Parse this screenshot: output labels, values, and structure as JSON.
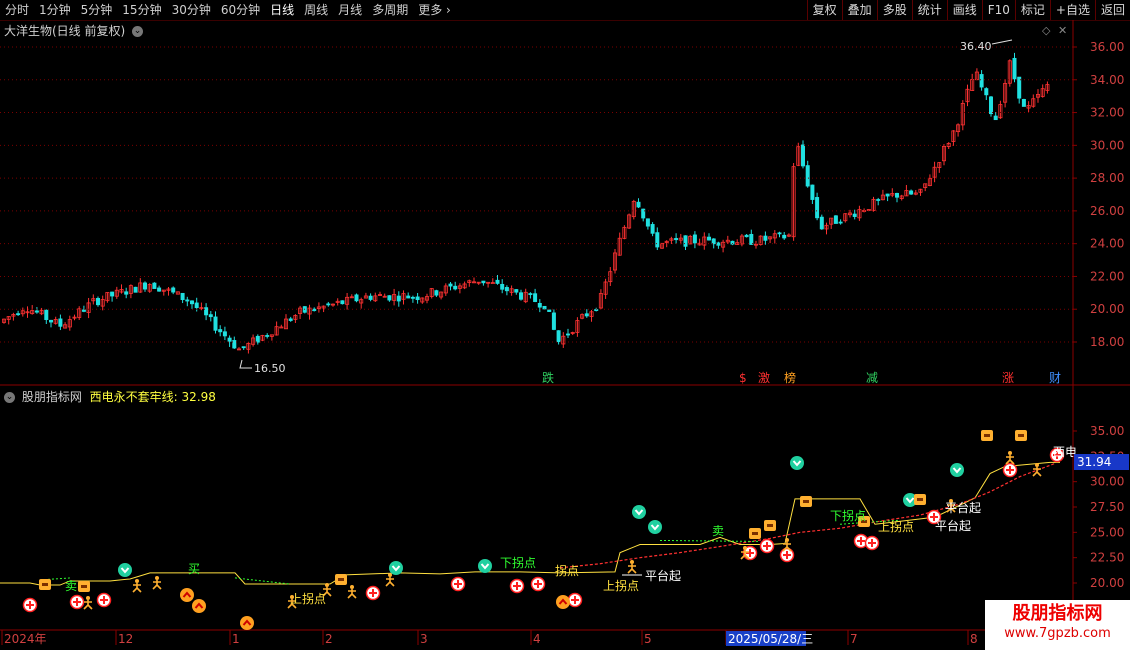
{
  "toolbar": {
    "periods": [
      "分时",
      "1分钟",
      "5分钟",
      "15分钟",
      "30分钟",
      "60分钟",
      "日线",
      "周线",
      "月线",
      "多周期",
      "更多"
    ],
    "active": "日线",
    "right": [
      "复权",
      "叠加",
      "多股",
      "统计",
      "画线",
      "F10",
      "标记",
      "+自选",
      "返回"
    ]
  },
  "main": {
    "title": "大洋生物(日线 前复权)",
    "y_ticks": [
      "36.00",
      "34.00",
      "32.00",
      "30.00",
      "28.00",
      "26.00",
      "24.00",
      "22.00",
      "20.00",
      "18.00"
    ],
    "high_label": "36.40",
    "low_label": "16.50",
    "event_marks": [
      {
        "text": "跌",
        "color": "#30d060"
      },
      {
        "text": "$",
        "color": "#ff3030"
      },
      {
        "text": "激",
        "color": "#ff3030"
      },
      {
        "text": "榜",
        "color": "#ffa020"
      },
      {
        "text": "减",
        "color": "#30d060"
      },
      {
        "text": "涨",
        "color": "#ff3030"
      },
      {
        "text": "财",
        "color": "#4090ff"
      }
    ]
  },
  "indicator": {
    "title": "股朋指标网",
    "line_name": "西电永不套牢线:",
    "line_value": "32.98",
    "y_ticks": [
      "35.00",
      "32.50",
      "30.00",
      "27.50",
      "25.00",
      "22.50",
      "20.00"
    ],
    "current_value": "31.94",
    "line_label": "西电",
    "labels": [
      "上拐点",
      "平台起",
      "上拐点",
      "平台起",
      "平台起",
      "上拐点",
      "下拐点",
      "下拐点",
      "卖",
      "卖",
      "买",
      "拐点"
    ]
  },
  "xaxis": {
    "labels": [
      "2024年",
      "12",
      "1",
      "2",
      "3",
      "4",
      "5",
      "2025/05/28/三",
      "7",
      "8"
    ]
  },
  "watermark": {
    "title": "股朋指标网",
    "url": "www.7gpzb.com"
  },
  "colors": {
    "up": "#ff3232",
    "down": "#20e0e0",
    "border": "#8b0000",
    "grid": "#7a0000"
  }
}
